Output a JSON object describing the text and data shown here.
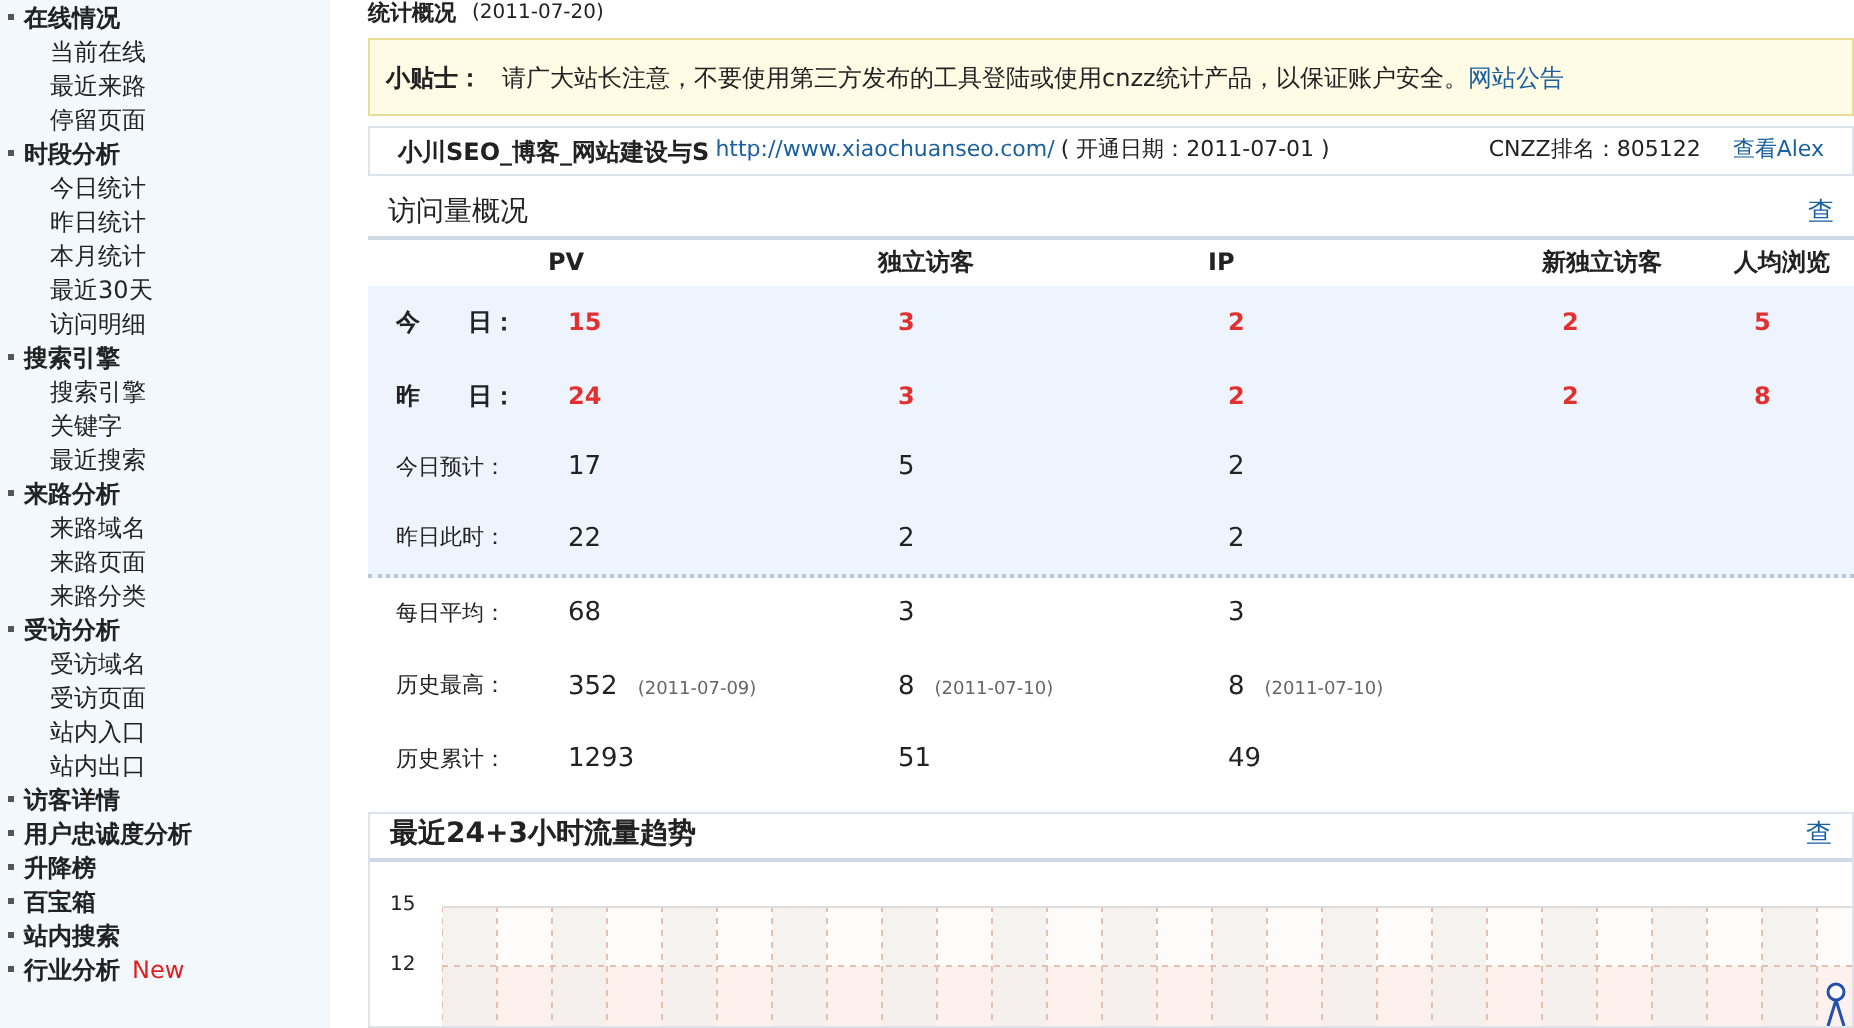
{
  "sidebar": {
    "groups": [
      {
        "label": "在线情况",
        "children": [
          {
            "label": "当前在线"
          },
          {
            "label": "最近来路"
          },
          {
            "label": "停留页面"
          }
        ]
      },
      {
        "label": "时段分析",
        "children": [
          {
            "label": "今日统计"
          },
          {
            "label": "昨日统计"
          },
          {
            "label": "本月统计"
          },
          {
            "label": "最近30天"
          },
          {
            "label": "访问明细"
          }
        ]
      },
      {
        "label": "搜索引擎",
        "children": [
          {
            "label": "搜索引擎"
          },
          {
            "label": "关键字"
          },
          {
            "label": "最近搜索"
          }
        ]
      },
      {
        "label": "来路分析",
        "children": [
          {
            "label": "来路域名"
          },
          {
            "label": "来路页面"
          },
          {
            "label": "来路分类"
          }
        ]
      },
      {
        "label": "受访分析",
        "children": [
          {
            "label": "受访域名"
          },
          {
            "label": "受访页面"
          },
          {
            "label": "站内入口"
          },
          {
            "label": "站内出口"
          }
        ]
      },
      {
        "label": "访客详情"
      },
      {
        "label": "用户忠诚度分析"
      },
      {
        "label": "升降榜"
      },
      {
        "label": "百宝箱"
      },
      {
        "label": "站内搜索"
      },
      {
        "label": "行业分析",
        "badge": "New"
      }
    ]
  },
  "page_header": {
    "title": "统计概况",
    "date": "(2011-07-20)"
  },
  "tip": {
    "label": "小贴士：",
    "text": "请广大站长注意，不要使用第三方发布的工具登陆或使用cnzz统计产品，以保证账户安全。",
    "link": "网站公告"
  },
  "site": {
    "name": "小川SEO_博客_网站建设与S",
    "url": "http://www.xiaochuanseo.com/",
    "opened": "( 开通日期：2011-07-01 )",
    "rank": "CNZZ排名：805122",
    "link": "查看Alex"
  },
  "overview": {
    "title": "访问量概况",
    "link": "查",
    "columns": [
      "PV",
      "独立访客",
      "IP",
      "新独立访客",
      "人均浏览"
    ],
    "rows": [
      {
        "label": "今　　日：",
        "shaded": true,
        "emphasis": true,
        "cells": [
          {
            "value": "15"
          },
          {
            "value": "3"
          },
          {
            "value": "2"
          },
          {
            "value": "2"
          },
          {
            "value": "5"
          }
        ]
      },
      {
        "label": "昨　　日：",
        "shaded": true,
        "emphasis": true,
        "cells": [
          {
            "value": "24"
          },
          {
            "value": "3"
          },
          {
            "value": "2"
          },
          {
            "value": "2"
          },
          {
            "value": "8"
          }
        ]
      },
      {
        "label": "今日预计：",
        "shaded": true,
        "emphasis": false,
        "cells": [
          {
            "value": "17"
          },
          {
            "value": "5"
          },
          {
            "value": "2"
          }
        ]
      },
      {
        "label": "昨日此时：",
        "shaded": true,
        "emphasis": false,
        "cells": [
          {
            "value": "22"
          },
          {
            "value": "2"
          },
          {
            "value": "2"
          }
        ]
      },
      {
        "label": "每日平均：",
        "shaded": false,
        "emphasis": false,
        "cells": [
          {
            "value": "68"
          },
          {
            "value": "3"
          },
          {
            "value": "3"
          }
        ]
      },
      {
        "label": "历史最高：",
        "shaded": false,
        "emphasis": false,
        "cells": [
          {
            "value": "352",
            "note": "(2011-07-09)"
          },
          {
            "value": "8",
            "note": "(2011-07-10)"
          },
          {
            "value": "8",
            "note": "(2011-07-10)"
          }
        ]
      },
      {
        "label": "历史累计：",
        "shaded": false,
        "emphasis": false,
        "cells": [
          {
            "value": "1293"
          },
          {
            "value": "51"
          },
          {
            "value": "49"
          }
        ]
      }
    ]
  },
  "trend": {
    "title": "最近24+3小时流量趋势",
    "link": "查",
    "y_tick_labels": [
      "15",
      "12"
    ]
  }
}
